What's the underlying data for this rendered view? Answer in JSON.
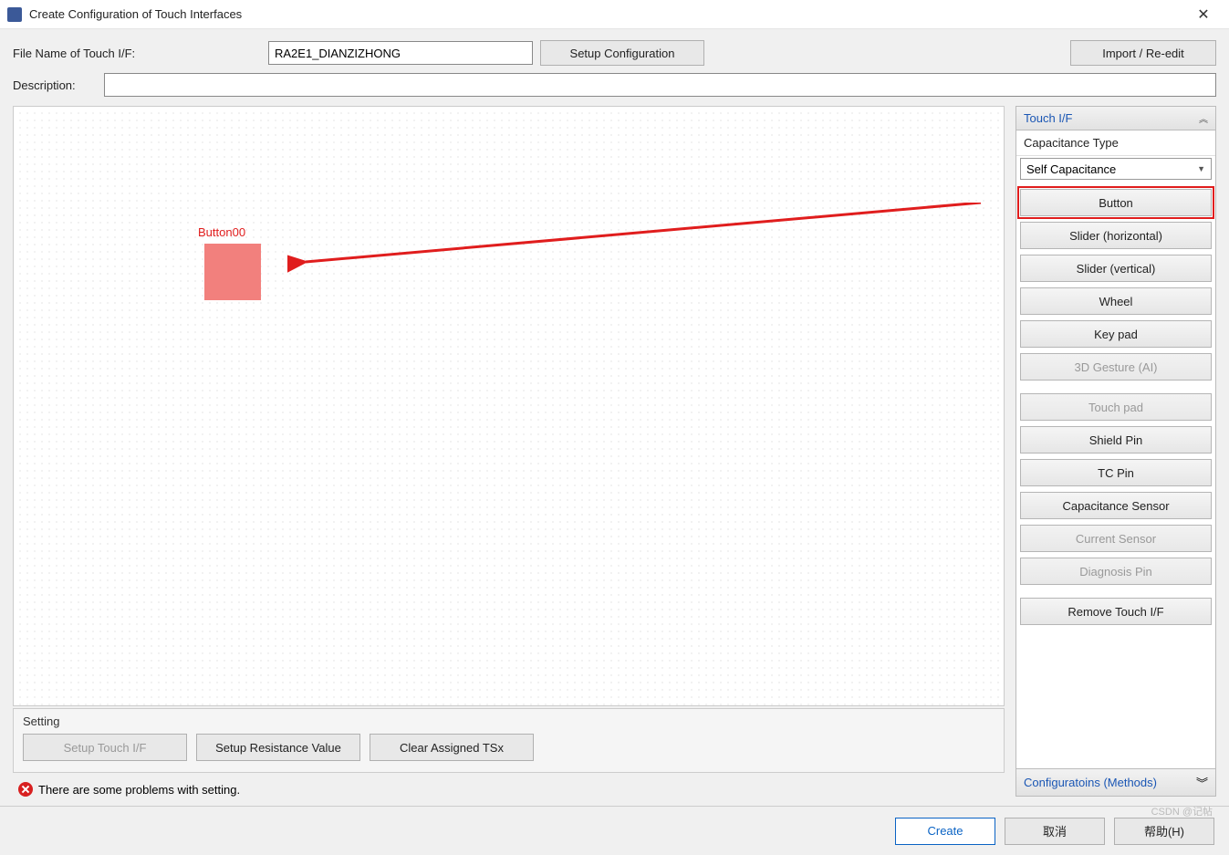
{
  "window": {
    "title": "Create Configuration of Touch Interfaces",
    "close_glyph": "✕"
  },
  "form": {
    "filename_label": "File Name of Touch I/F:",
    "filename_value": "RA2E1_DIANZIZHONG",
    "setup_conf_label": "Setup Configuration",
    "import_label": "Import / Re-edit",
    "description_label": "Description:",
    "description_value": ""
  },
  "canvas": {
    "button00_label": "Button00"
  },
  "palette": {
    "header": "Touch I/F",
    "cap_type_label": "Capacitance Type",
    "cap_type_value": "Self Capacitance",
    "items_a": [
      "Button",
      "Slider (horizontal)",
      "Slider (vertical)",
      "Wheel",
      "Key pad",
      "3D Gesture (AI)"
    ],
    "items_a_disabled": [
      false,
      false,
      false,
      false,
      false,
      true
    ],
    "items_b": [
      "Touch pad",
      "Shield Pin",
      "TC Pin",
      "Capacitance Sensor",
      "Current Sensor",
      "Diagnosis Pin"
    ],
    "items_b_disabled": [
      true,
      false,
      false,
      false,
      true,
      true
    ],
    "remove_label": "Remove Touch I/F",
    "selected": "Button",
    "conf_header": "Configuratoins (Methods)"
  },
  "setting": {
    "title": "Setting",
    "setup_if_label": "Setup Touch I/F",
    "resistance_label": "Setup Resistance Value",
    "clear_label": "Clear Assigned TSx"
  },
  "problem": {
    "text": "There are some problems with setting."
  },
  "actions": {
    "create": "Create",
    "cancel": "取消",
    "help": "帮助(H)"
  },
  "watermark": "CSDN @记帖"
}
